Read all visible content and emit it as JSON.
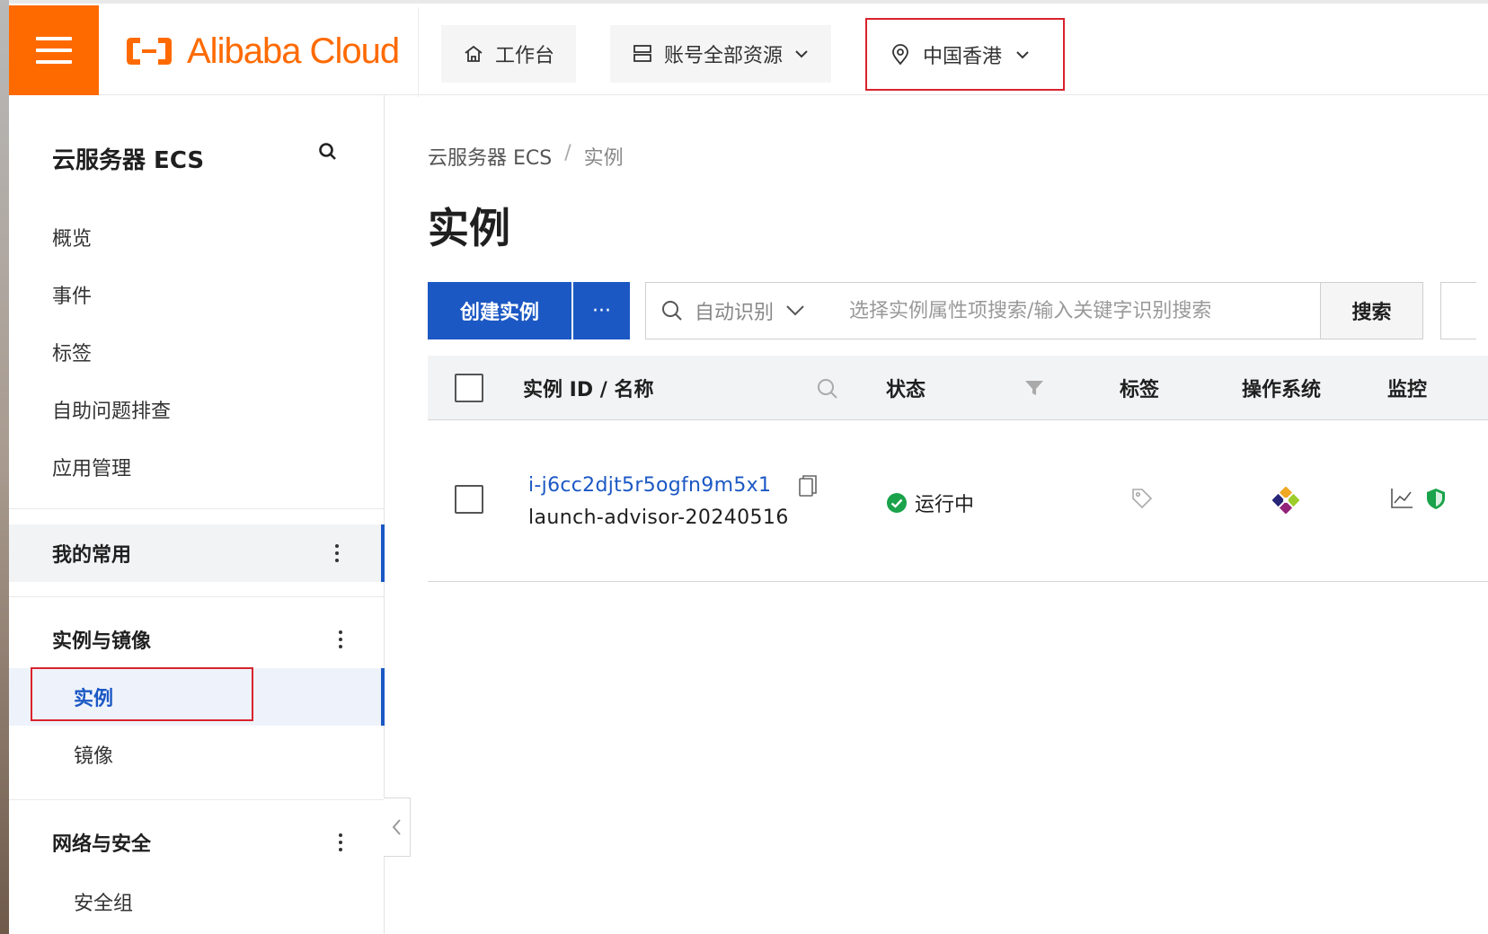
{
  "header": {
    "brand": "Alibaba Cloud",
    "workbench": "工作台",
    "resources": "账号全部资源",
    "region": "中国香港"
  },
  "sidebar": {
    "title": "云服务器 ECS",
    "items": [
      "概览",
      "事件",
      "标签",
      "自助问题排查",
      "应用管理"
    ],
    "groups": [
      {
        "label": "我的常用"
      },
      {
        "label": "实例与镜像",
        "children": [
          "实例",
          "镜像"
        ]
      },
      {
        "label": "网络与安全",
        "children": [
          "安全组"
        ]
      }
    ]
  },
  "main": {
    "breadcrumb": [
      "云服务器 ECS",
      "实例"
    ],
    "title": "实例",
    "create_button": "创建实例",
    "more_button": "···",
    "search_type": "自动识别",
    "search_placeholder": "选择实例属性项搜索/输入关键字识别搜索",
    "search_button": "搜索",
    "columns": [
      "实例 ID / 名称",
      "状态",
      "标签",
      "操作系统",
      "监控"
    ],
    "rows": [
      {
        "id": "i-j6cc2djt5r5ogfn9m5x1",
        "name": "launch-advisor-20240516",
        "status": "运行中"
      }
    ]
  },
  "colors": {
    "brand_orange": "#ff6a00",
    "primary_blue": "#1b58c4",
    "highlight_red": "#d9232e",
    "running_green": "#1aa34a"
  }
}
